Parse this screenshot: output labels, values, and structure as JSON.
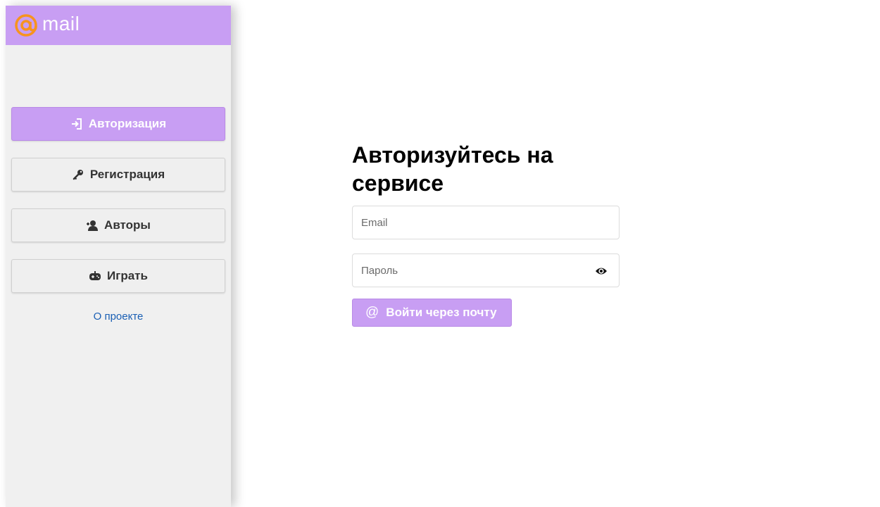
{
  "brand": {
    "logo_text": "mail",
    "accent_color": "#c89ef3",
    "logo_at_color": "#f7931e"
  },
  "sidebar": {
    "items": [
      {
        "label": "Авторизация",
        "icon": "sign-in-icon",
        "active": true
      },
      {
        "label": "Регистрация",
        "icon": "key-icon",
        "active": false
      },
      {
        "label": "Авторы",
        "icon": "users-icon",
        "active": false
      },
      {
        "label": "Играть",
        "icon": "gamepad-icon",
        "active": false
      }
    ],
    "about_link": "О проекте"
  },
  "main": {
    "title": "Авторизуйтесь на сервисе",
    "email_placeholder": "Email",
    "password_placeholder": "Пароль",
    "login_button": "Войти через почту",
    "login_button_icon": "@"
  }
}
